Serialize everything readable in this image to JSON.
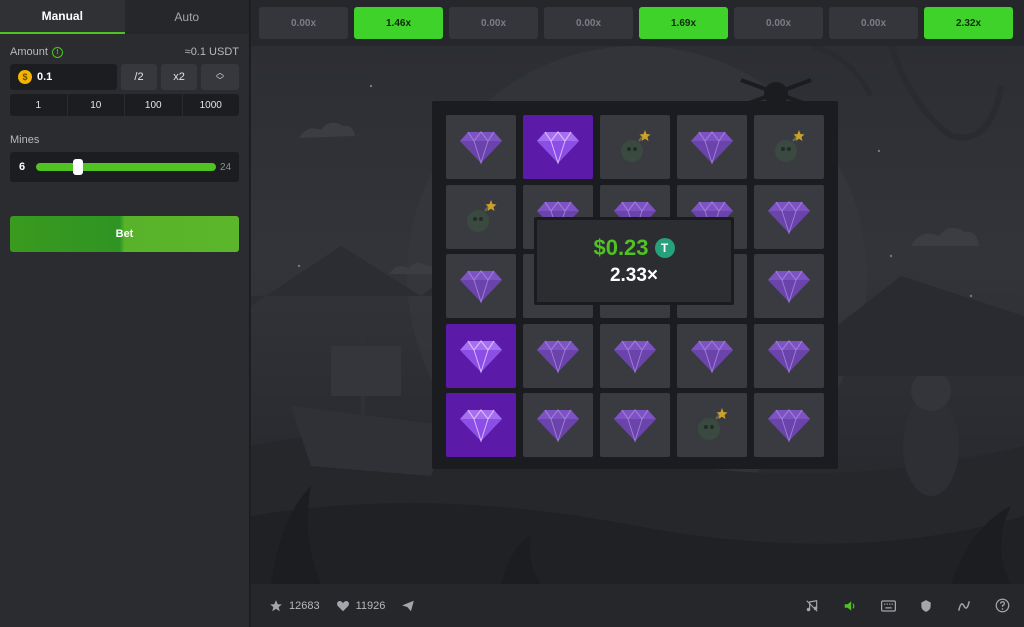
{
  "left_panel": {
    "tabs": [
      "Manual",
      "Auto"
    ],
    "amount_label": "Amount",
    "amount_approx": "≈0.1 USDT",
    "amount_value": "0.1",
    "coin_symbol": "$",
    "half_label": "/2",
    "double_label": "x2",
    "presets": [
      "1",
      "10",
      "100",
      "1000"
    ],
    "mines_label": "Mines",
    "mines_value": "6",
    "mines_max": "24",
    "mines_level_fraction": 0.22,
    "bet_label": "Bet"
  },
  "multipliers": [
    {
      "label": "0.00x",
      "hit": false
    },
    {
      "label": "1.46x",
      "hit": true
    },
    {
      "label": "0.00x",
      "hit": false
    },
    {
      "label": "0.00x",
      "hit": false
    },
    {
      "label": "1.69x",
      "hit": true
    },
    {
      "label": "0.00x",
      "hit": false
    },
    {
      "label": "0.00x",
      "hit": false
    },
    {
      "label": "2.32x",
      "hit": true
    }
  ],
  "board": {
    "rows": [
      [
        "gem-dim",
        "gem-revealed",
        "mine",
        "gem-dim",
        "mine"
      ],
      [
        "mine",
        "gem-dim",
        "gem-dim",
        "gem-dim",
        "gem-dim"
      ],
      [
        "gem-dim",
        "gem-dim",
        "gem-dim",
        "gem-dim",
        "gem-dim"
      ],
      [
        "gem-revealed",
        "gem-dim",
        "gem-dim",
        "gem-dim",
        "gem-dim"
      ],
      [
        "gem-revealed",
        "gem-dim",
        "gem-dim",
        "mine",
        "gem-dim"
      ]
    ]
  },
  "result": {
    "amount": "$0.23",
    "currency_icon": "T",
    "multiplier": "2.33×"
  },
  "bottom_bar": {
    "favorites": "12683",
    "likes": "11926",
    "icons": [
      "music-icon",
      "sound-icon",
      "keyboard-icon",
      "fairness-icon",
      "stats-icon",
      "help-icon"
    ]
  },
  "colors": {
    "accent": "#4ec322",
    "multiplier_hit": "#3fd22b",
    "gem": "#8b5cd6",
    "revealed_tile": "#5b1aa8"
  }
}
